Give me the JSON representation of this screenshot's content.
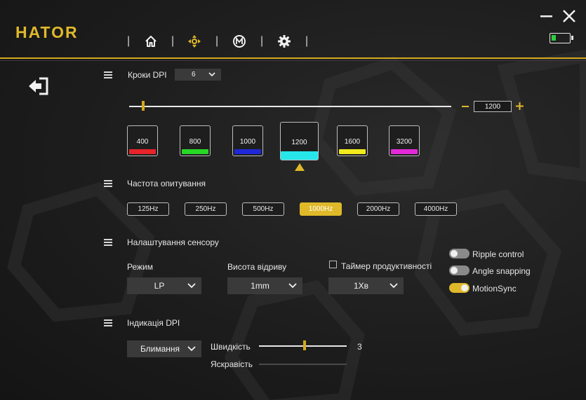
{
  "app": {
    "logo": "HATOR"
  },
  "nav": {
    "items": [
      {
        "name": "home",
        "icon": "home-icon"
      },
      {
        "name": "dpi",
        "icon": "crosshair-icon"
      },
      {
        "name": "macro",
        "icon": "macro-m-icon"
      },
      {
        "name": "settings",
        "icon": "gear-icon"
      }
    ],
    "active": "dpi"
  },
  "battery": {
    "level_fraction": 0.25,
    "color": "#2ecc40"
  },
  "dpi_steps": {
    "title": "Кроки DPI",
    "steps_value": "6",
    "slider_value": "1200",
    "slider_fraction": 0.04,
    "levels": [
      {
        "value": "400",
        "color": "#e8232a"
      },
      {
        "value": "800",
        "color": "#27d826"
      },
      {
        "value": "1000",
        "color": "#1f28d8"
      },
      {
        "value": "1200",
        "color": "#27e6ea",
        "selected": true
      },
      {
        "value": "1600",
        "color": "#f2ea1c"
      },
      {
        "value": "3200",
        "color": "#e22ad9"
      }
    ]
  },
  "polling": {
    "title": "Частота опитування",
    "rates": [
      "125Hz",
      "250Hz",
      "500Hz",
      "1000Hz",
      "2000Hz",
      "4000Hz"
    ],
    "active_index": 3
  },
  "sensor": {
    "title": "Налаштування сенсору",
    "mode_label": "Режим",
    "mode_value": "LP",
    "lod_label": "Висота відриву",
    "lod_value": "1mm",
    "timer_label": "Таймер продуктивності",
    "timer_value": "1Хв",
    "toggles": [
      {
        "label": "Ripple control",
        "on": false
      },
      {
        "label": "Angle snapping",
        "on": false
      },
      {
        "label": "MotionSync",
        "on": true
      }
    ]
  },
  "indication": {
    "title": "Індикація DPI",
    "effect_value": "Блимання",
    "speed_label": "Швидкість",
    "speed_value": "3",
    "speed_fraction": 0.5,
    "brightness_label": "Яскравість"
  },
  "colors": {
    "accent": "#e0b92a"
  }
}
